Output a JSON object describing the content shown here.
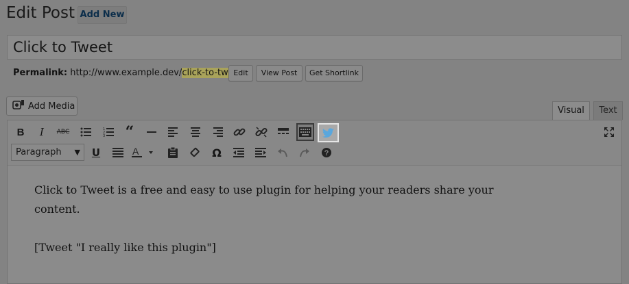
{
  "header": {
    "title": "Edit Post",
    "add_new": "Add New"
  },
  "post": {
    "title": "Click to Tweet"
  },
  "permalink": {
    "label": "Permalink:",
    "url_prefix": "http://www.example.dev/",
    "slug": "click-to-tweet",
    "url_suffix": "/",
    "edit_label": "Edit",
    "view_label": "View Post",
    "shortlink_label": "Get Shortlink"
  },
  "media": {
    "add_media_label": "Add Media"
  },
  "editor_tabs": {
    "visual": "Visual",
    "text": "Text"
  },
  "toolbar": {
    "format_select_value": "Paragraph",
    "row1_icons": [
      "bold-icon",
      "italic-icon",
      "strikethrough-icon",
      "bulleted-list-icon",
      "numbered-list-icon",
      "blockquote-icon",
      "horizontal-line-icon",
      "align-left-icon",
      "align-center-icon",
      "align-right-icon",
      "link-icon",
      "unlink-icon",
      "read-more-icon",
      "toolbar-toggle-icon",
      "twitter-bird-icon"
    ],
    "row2_icons": [
      "underline-icon",
      "justify-icon",
      "text-color-icon",
      "paste-as-text-icon",
      "clear-formatting-icon",
      "special-character-icon",
      "outdent-icon",
      "indent-icon",
      "undo-icon",
      "redo-icon",
      "help-icon"
    ],
    "accent_color": "#5aa7dd"
  },
  "content": {
    "paragraph1": "Click to Tweet is a free and easy to use plugin for helping your readers share your content.",
    "paragraph2": "[Tweet \"I really like this plugin\"]"
  }
}
